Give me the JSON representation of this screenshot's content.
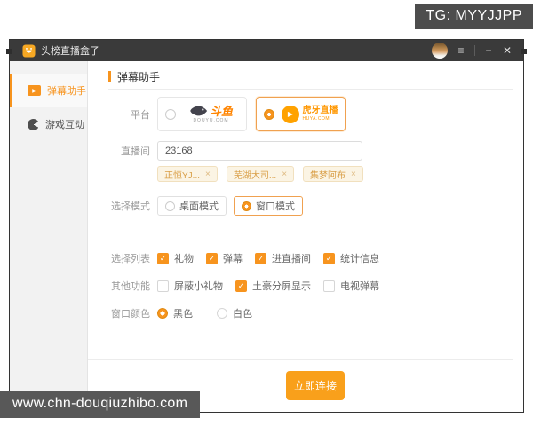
{
  "overlays": {
    "tg_badge": "TG: MYYJJPP",
    "site_badge": "www.chn-douqiuzhibo.com"
  },
  "titlebar": {
    "title": "头榜直播盒子"
  },
  "window_controls": {
    "menu": "≡",
    "minimize": "−",
    "close": "✕"
  },
  "icons": {
    "check": "✓",
    "play": "▶"
  },
  "sidebar": {
    "items": [
      {
        "label": "弹幕助手",
        "active": true
      },
      {
        "label": "游戏互动",
        "active": false
      }
    ]
  },
  "main": {
    "section_title": "弹幕助手",
    "platform": {
      "label": "平台",
      "options": [
        {
          "name": "斗鱼",
          "site": "DOUYU.COM",
          "selected": false
        },
        {
          "name": "虎牙直播",
          "site": "HUYA.COM",
          "selected": true
        }
      ]
    },
    "room": {
      "label": "直播间",
      "value": "23168"
    },
    "tags": [
      {
        "text": "正恒YJ...",
        "remove": "×"
      },
      {
        "text": "芜湖大司...",
        "remove": "×"
      },
      {
        "text": "集梦阿布",
        "remove": "×"
      }
    ],
    "mode": {
      "label": "选择模式",
      "options": [
        {
          "text": "桌面模式",
          "selected": false
        },
        {
          "text": "窗口模式",
          "selected": true
        }
      ]
    },
    "list": {
      "label": "选择列表",
      "options": [
        {
          "text": "礼物",
          "checked": true
        },
        {
          "text": "弹幕",
          "checked": true
        },
        {
          "text": "进直播间",
          "checked": true
        },
        {
          "text": "统计信息",
          "checked": true
        }
      ]
    },
    "other": {
      "label": "其他功能",
      "options": [
        {
          "text": "屏蔽小礼物",
          "checked": false
        },
        {
          "text": "土豪分屏显示",
          "checked": true
        },
        {
          "text": "电视弹幕",
          "checked": false
        }
      ]
    },
    "color": {
      "label": "窗口颜色",
      "options": [
        {
          "text": "黑色",
          "selected": true
        },
        {
          "text": "白色",
          "selected": false
        }
      ]
    },
    "connect_button": "立即连接"
  },
  "colors": {
    "accent": "#F7941E",
    "titlebar_bg": "#3A3A3A",
    "badge_bg": "#4D4D4D"
  }
}
